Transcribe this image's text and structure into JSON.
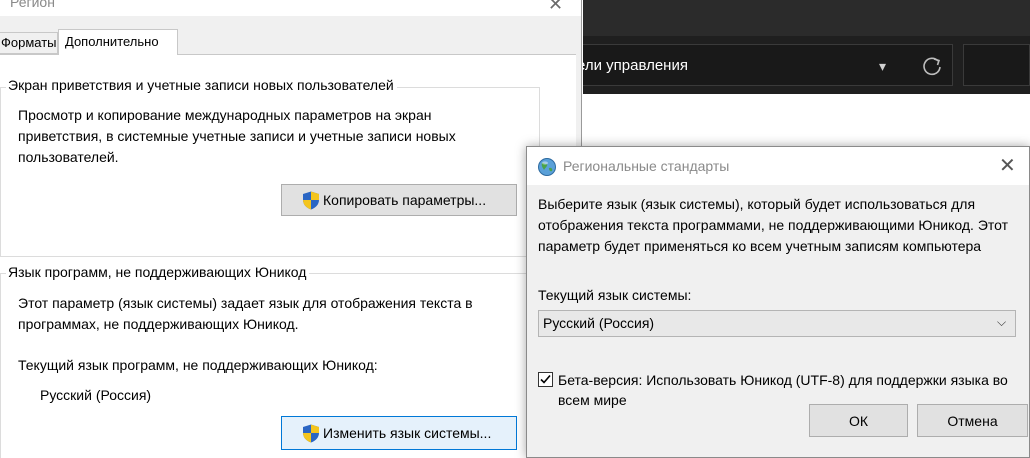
{
  "background_window": {
    "address_text": "ели управления",
    "chevron": "▾",
    "refresh_icon": "refresh-icon"
  },
  "region_window": {
    "title": "Регион",
    "close": "✕",
    "tabs": [
      {
        "label": "Форматы"
      },
      {
        "label": "Дополнительно",
        "active": true
      }
    ],
    "welcome_group": {
      "title": "Экран приветствия и учетные записи новых пользователей",
      "description": "Просмотр и копирование международных параметров на экран приветствия, в системные учетные записи и учетные записи новых пользователей.",
      "copy_button": "Копировать параметры..."
    },
    "unicode_group": {
      "title": "Язык программ, не поддерживающих Юникод",
      "description": "Этот параметр (язык системы) задает язык для отображения текста в программах, не поддерживающих Юникод.",
      "current_label": "Текущий язык программ, не поддерживающих Юникод:",
      "current_value": "Русский (Россия)",
      "change_button": "Изменить язык системы..."
    }
  },
  "dialog": {
    "title": "Региональные стандарты",
    "close": "✕",
    "description": "Выберите язык (язык системы), который будет использоваться для отображения текста программами, не поддерживающими Юникод. Этот параметр будет применяться ко всем учетным записям компьютера",
    "current_locale_label": "Текущий язык системы:",
    "current_locale_value": "Русский (Россия)",
    "chevron": "⌵",
    "utf8_checkbox_checked": true,
    "utf8_label": "Бета-версия: Использовать Юникод (UTF-8) для поддержки языка во всем мире",
    "ok_label": "ОК",
    "cancel_label": "Отмена"
  },
  "colors": {
    "dark_bar": "#1f1f1f",
    "focus_border": "#0078d7",
    "dialog_bg": "#f0f0f0"
  }
}
